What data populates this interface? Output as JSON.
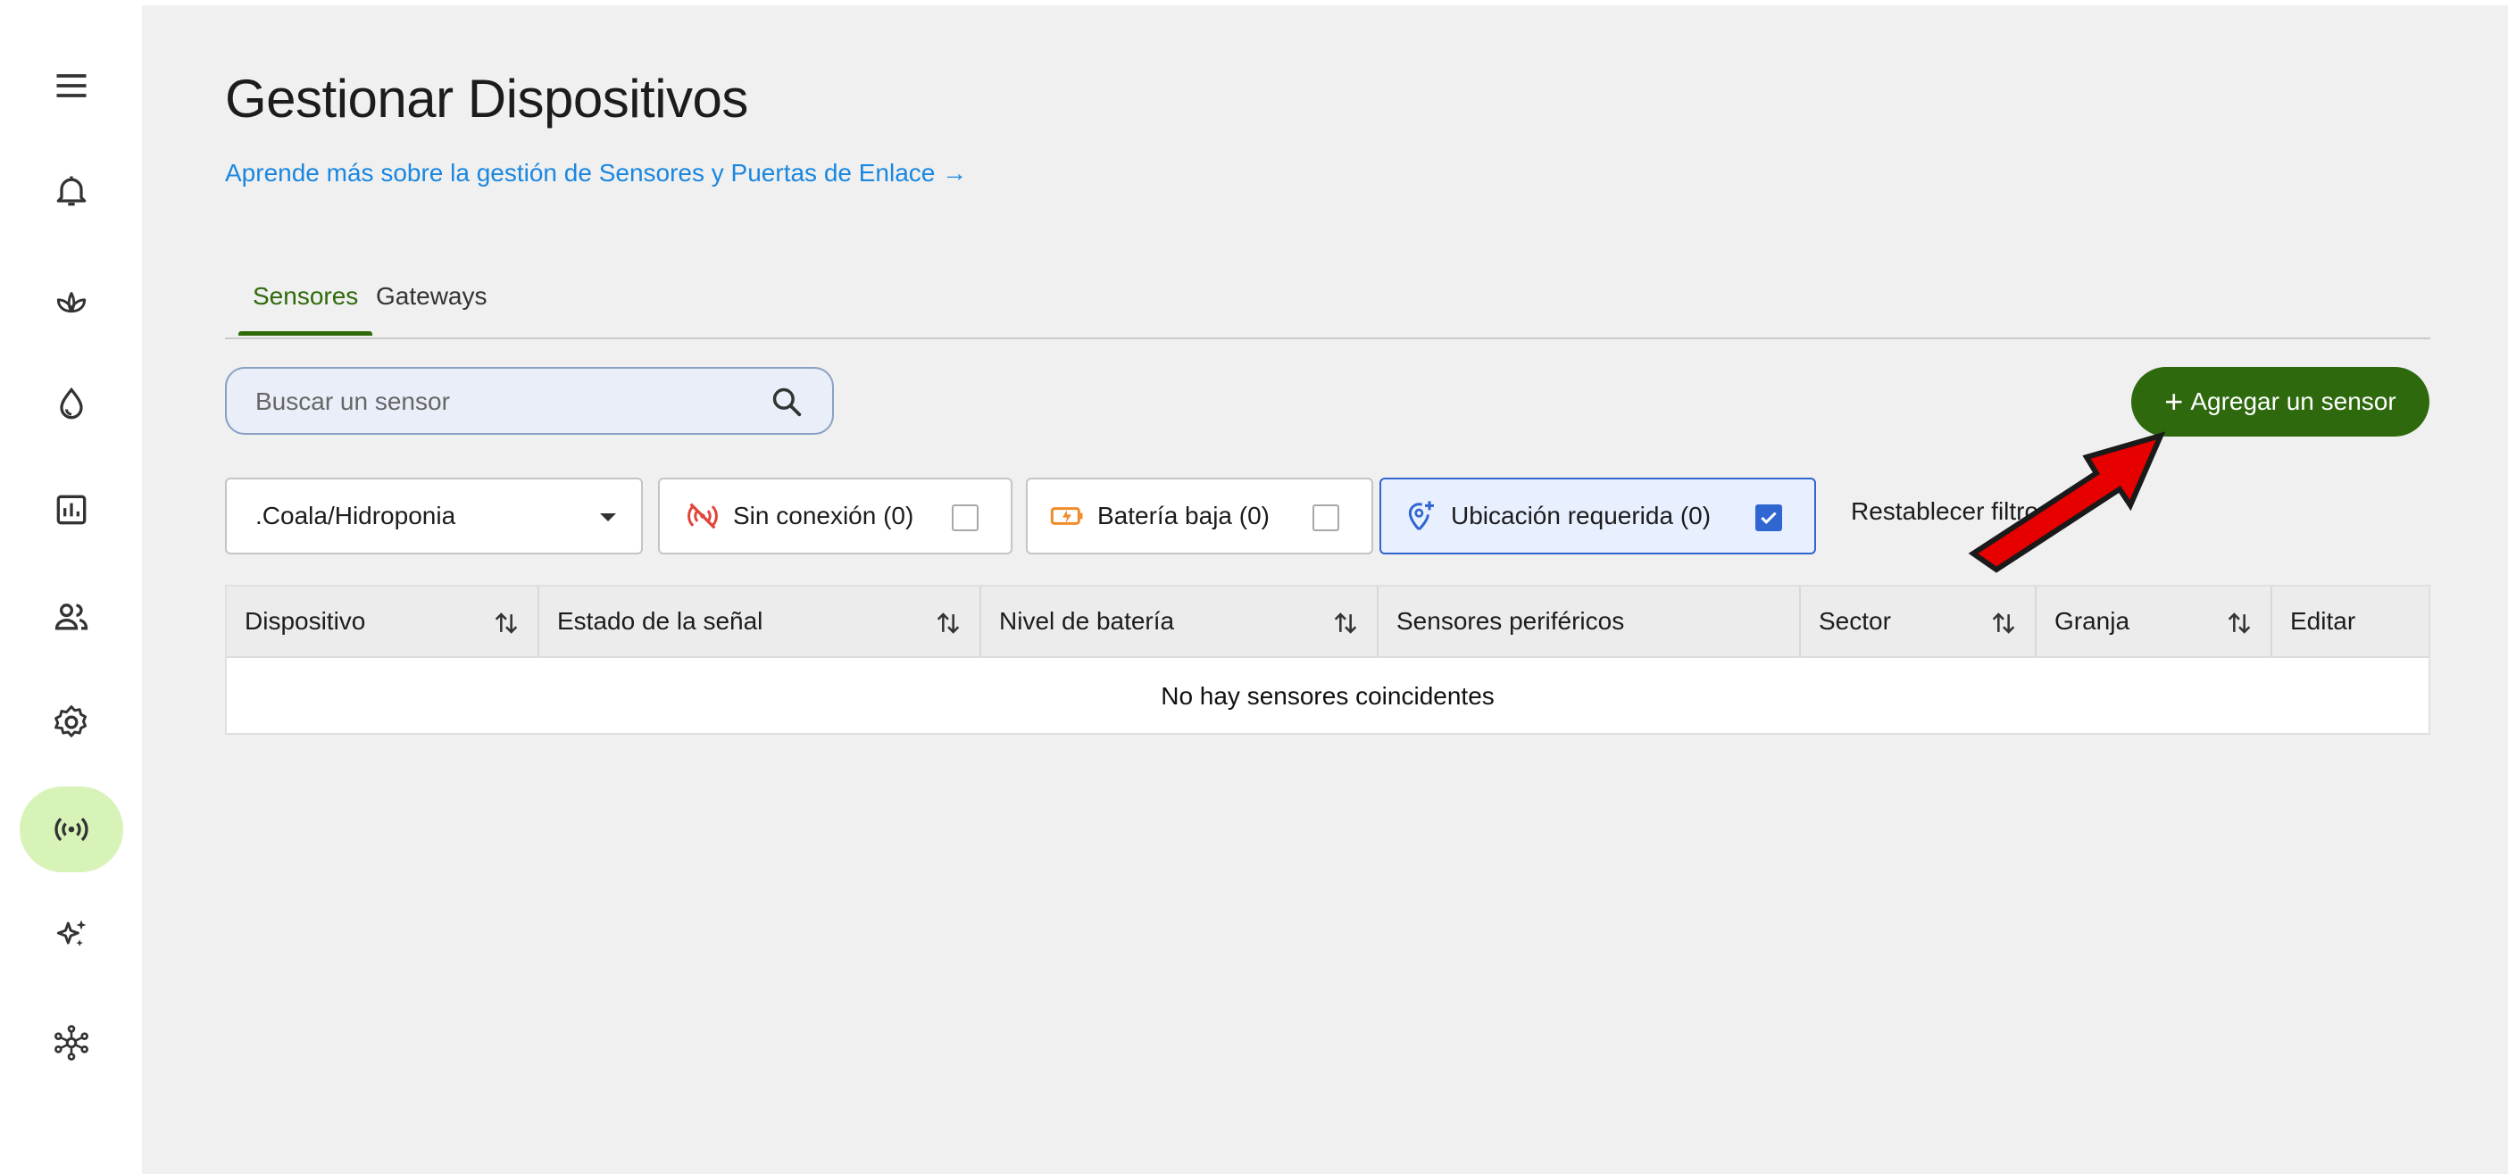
{
  "sidebar": {
    "items": [
      {
        "icon": "menu-icon"
      },
      {
        "icon": "bell-icon"
      },
      {
        "icon": "plant-icon"
      },
      {
        "icon": "water-drop-icon"
      },
      {
        "icon": "bar-chart-icon"
      },
      {
        "icon": "users-icon"
      },
      {
        "icon": "gear-icon"
      },
      {
        "icon": "broadcast-icon",
        "active": true
      },
      {
        "icon": "sparkle-icon"
      },
      {
        "icon": "network-icon"
      }
    ]
  },
  "header": {
    "title": "Gestionar Dispositivos",
    "learn_link": "Aprende más sobre la gestión de Sensores y Puertas de Enlace →"
  },
  "tabs": [
    {
      "label": "Sensores",
      "active": true
    },
    {
      "label": "Gateways",
      "active": false
    }
  ],
  "search": {
    "placeholder": "Buscar un sensor",
    "value": ""
  },
  "add_button": {
    "label": "Agregar un sensor",
    "icon": "plus-icon"
  },
  "filters": {
    "farm": {
      "selected": ".Coala/Hidroponia"
    },
    "offline": {
      "label": "Sin conexión (0)",
      "checked": false,
      "icon": "no-signal-icon"
    },
    "battery": {
      "label": "Batería baja (0)",
      "checked": false,
      "icon": "low-battery-icon"
    },
    "location": {
      "label": "Ubicación requerida (0)",
      "checked": true,
      "icon": "add-location-icon"
    },
    "reset_label": "Restablecer filtros"
  },
  "table": {
    "columns": [
      {
        "label": "Dispositivo",
        "sortable": true
      },
      {
        "label": "Estado de la señal",
        "sortable": true
      },
      {
        "label": "Nivel de batería",
        "sortable": true
      },
      {
        "label": "Sensores periféricos",
        "sortable": false
      },
      {
        "label": "Sector",
        "sortable": true
      },
      {
        "label": "Granja",
        "sortable": true
      },
      {
        "label": "Editar",
        "sortable": false
      }
    ],
    "empty_message": "No hay sensores coincidentes"
  },
  "colors": {
    "accent_green": "#2e6a0d",
    "active_nav_bg": "#d7f3b8",
    "link_blue": "#1a87e0",
    "checkbox_blue": "#2f66d0",
    "annotation_arrow": "#e60000"
  }
}
